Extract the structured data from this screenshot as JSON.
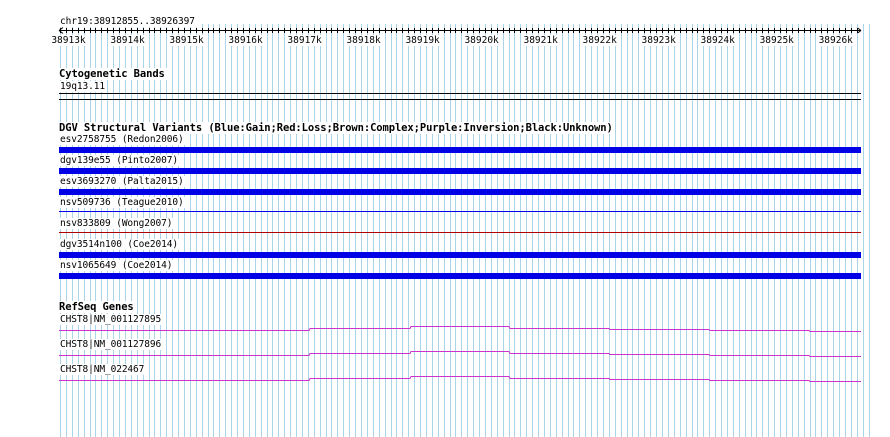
{
  "ruler": {
    "region_label": "chr19:38912855..38926397",
    "ticks": [
      "38913k",
      "38914k",
      "38915k",
      "38916k",
      "38917k",
      "38918k",
      "38919k",
      "38920k",
      "38921k",
      "38922k",
      "38923k",
      "38924k",
      "38925k",
      "38926k"
    ]
  },
  "cytoband": {
    "title": "Cytogenetic Bands",
    "band": "19q13.11"
  },
  "dgv": {
    "title": "DGV Structural Variants (Blue:Gain;Red:Loss;Brown:Complex;Purple:Inversion;Black:Unknown)",
    "tracks": [
      {
        "label": "esv2758755 (Redon2006)",
        "color": "#0000e6",
        "type": "Gain"
      },
      {
        "label": "dgv139e55 (Pinto2007)",
        "color": "#0000e6",
        "type": "Gain"
      },
      {
        "label": "esv3693270 (Palta2015)",
        "color": "#0000e6",
        "type": "Gain"
      },
      {
        "label": "nsv509736 (Teague2010)",
        "color": "#0000e6",
        "type": "Gain"
      },
      {
        "label": "nsv833809 (Wong2007)",
        "color": "#b00000",
        "type": "Loss"
      },
      {
        "label": "dgv3514n100 (Coe2014)",
        "color": "#0000e6",
        "type": "Gain"
      },
      {
        "label": "nsv1065649 (Coe2014)",
        "color": "#0000e6",
        "type": "Gain"
      }
    ]
  },
  "refseq": {
    "title": "RefSeq Genes",
    "genes": [
      {
        "label": "CHST8|NM_001127895"
      },
      {
        "label": "CHST8|NM_001127896"
      },
      {
        "label": "CHST8|NM_022467"
      }
    ],
    "color": "#cc33cc"
  }
}
